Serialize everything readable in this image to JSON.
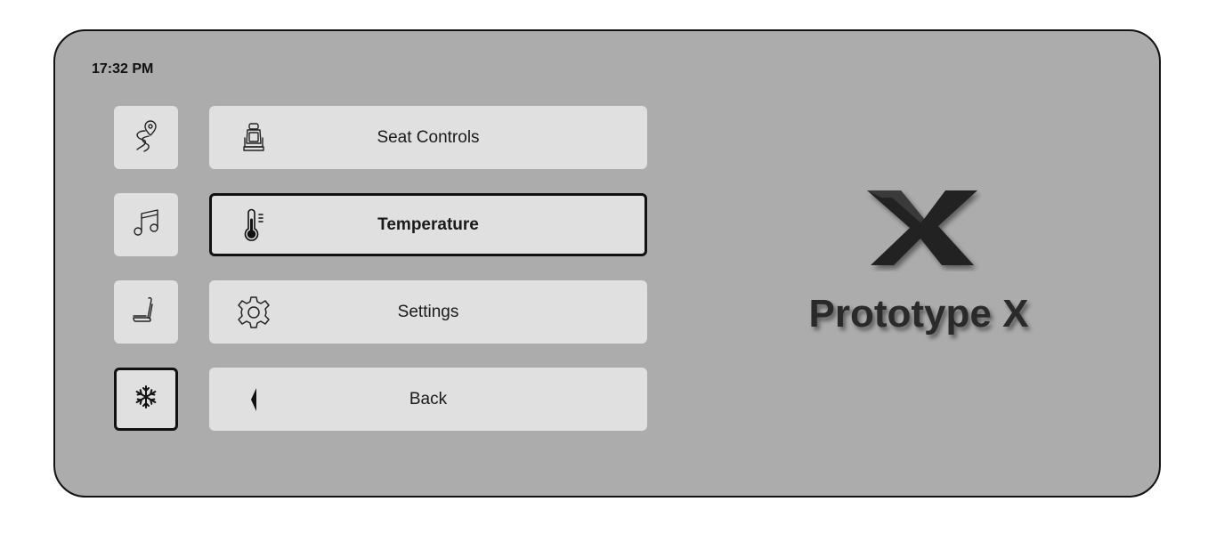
{
  "status": {
    "time": "17:32 PM"
  },
  "sidebar": {
    "items": [
      {
        "name": "navigation",
        "icon": "route-pin-icon",
        "active": false
      },
      {
        "name": "music",
        "icon": "music-note-icon",
        "active": false
      },
      {
        "name": "seat",
        "icon": "seat-recline-icon",
        "active": false
      },
      {
        "name": "climate",
        "icon": "snowflake-icon",
        "active": true
      }
    ]
  },
  "menu": {
    "items": [
      {
        "label": "Seat Controls",
        "icon": "car-seat-icon",
        "active": false
      },
      {
        "label": "Temperature",
        "icon": "thermometer-icon",
        "active": true
      },
      {
        "label": "Settings",
        "icon": "gear-icon",
        "active": false
      },
      {
        "label": "Back",
        "icon": "back-arrow-icon",
        "active": false
      }
    ]
  },
  "brand": {
    "name": "Prototype X",
    "logo_color": "#222222"
  },
  "colors": {
    "background": "#acacac",
    "button": "#e0e0e0",
    "active_border": "#111111"
  }
}
